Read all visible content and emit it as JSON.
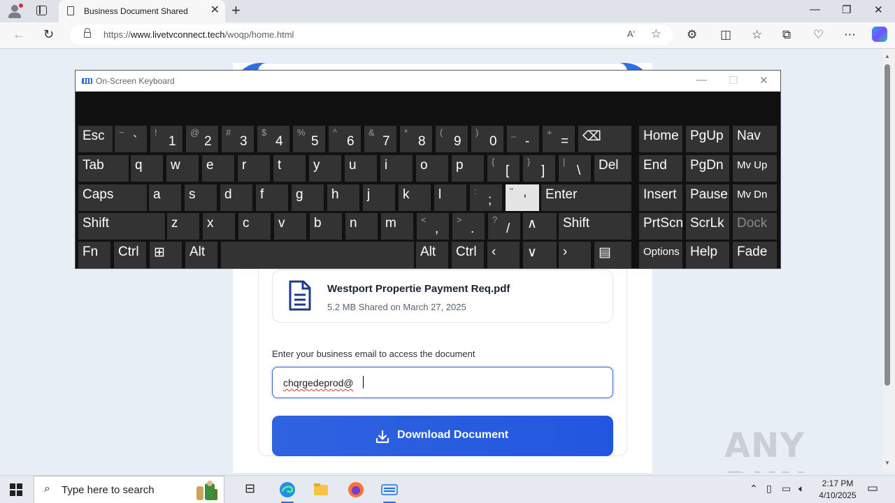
{
  "browser": {
    "tab_title": "Business Document Shared",
    "url_prefix": "https://",
    "url_host": "www.livetvconnect.tech",
    "url_path": "/woqp/home.html",
    "read_aloud": "Aʹ"
  },
  "document": {
    "file_name": "Westport Propertie Payment Req.pdf",
    "file_meta": "5.2 MB Shared on March 27, 2025",
    "email_label": "Enter your business email to access the document",
    "email_value": "chqrgedeprod@",
    "download_label": "Download Document",
    "accent_color": "#2e6ee6"
  },
  "osk": {
    "title": "On-Screen Keyboard",
    "rows": [
      [
        {
          "main": "Esc"
        },
        {
          "shift": "~",
          "main": "`"
        },
        {
          "shift": "!",
          "main": "1"
        },
        {
          "shift": "@",
          "main": "2"
        },
        {
          "shift": "#",
          "main": "3"
        },
        {
          "shift": "$",
          "main": "4"
        },
        {
          "shift": "%",
          "main": "5"
        },
        {
          "shift": "^",
          "main": "6"
        },
        {
          "shift": "&",
          "main": "7"
        },
        {
          "shift": "*",
          "main": "8"
        },
        {
          "shift": "(",
          "main": "9"
        },
        {
          "shift": ")",
          "main": "0"
        },
        {
          "shift": "_",
          "main": "-"
        },
        {
          "shift": "+",
          "main": "="
        },
        {
          "main": "⌫"
        },
        {
          "main": "Home"
        },
        {
          "main": "PgUp"
        },
        {
          "main": "Nav"
        }
      ],
      [
        {
          "main": "Tab"
        },
        {
          "main": "q"
        },
        {
          "main": "w"
        },
        {
          "main": "e"
        },
        {
          "main": "r"
        },
        {
          "main": "t"
        },
        {
          "main": "y"
        },
        {
          "main": "u"
        },
        {
          "main": "i"
        },
        {
          "main": "o"
        },
        {
          "main": "p"
        },
        {
          "shift": "{",
          "main": "["
        },
        {
          "shift": "}",
          "main": "]"
        },
        {
          "shift": "|",
          "main": "\\"
        },
        {
          "main": "Del"
        },
        {
          "main": "End"
        },
        {
          "main": "PgDn"
        },
        {
          "main": "Mv Up"
        }
      ],
      [
        {
          "main": "Caps"
        },
        {
          "main": "a"
        },
        {
          "main": "s"
        },
        {
          "main": "d"
        },
        {
          "main": "f"
        },
        {
          "main": "g"
        },
        {
          "main": "h"
        },
        {
          "main": "j"
        },
        {
          "main": "k"
        },
        {
          "main": "l"
        },
        {
          "shift": ":",
          "main": ";"
        },
        {
          "shift": "\"",
          "main": "'"
        },
        {
          "main": "Enter"
        },
        {
          "main": "Insert"
        },
        {
          "main": "Pause"
        },
        {
          "main": "Mv Dn"
        }
      ],
      [
        {
          "main": "Shift"
        },
        {
          "main": "z"
        },
        {
          "main": "x"
        },
        {
          "main": "c"
        },
        {
          "main": "v"
        },
        {
          "main": "b"
        },
        {
          "main": "n"
        },
        {
          "main": "m"
        },
        {
          "shift": "<",
          "main": ","
        },
        {
          "shift": ">",
          "main": "."
        },
        {
          "shift": "?",
          "main": "/"
        },
        {
          "main": "∧"
        },
        {
          "main": "Shift"
        },
        {
          "main": "PrtScn"
        },
        {
          "main": "ScrLk"
        },
        {
          "main": "Dock"
        }
      ],
      [
        {
          "main": "Fn"
        },
        {
          "main": "Ctrl"
        },
        {
          "main": "⊞"
        },
        {
          "main": "Alt"
        },
        {
          "main": ""
        },
        {
          "main": "Alt"
        },
        {
          "main": "Ctrl"
        },
        {
          "main": "‹"
        },
        {
          "main": "∨"
        },
        {
          "main": "›"
        },
        {
          "main": "▤"
        },
        {
          "main": "Options"
        },
        {
          "main": "Help"
        },
        {
          "main": "Fade"
        }
      ]
    ]
  },
  "taskbar": {
    "search_placeholder": "Type here to search",
    "time": "2:17 PM",
    "date": "4/10/2025"
  },
  "watermark": "ANY RUN"
}
